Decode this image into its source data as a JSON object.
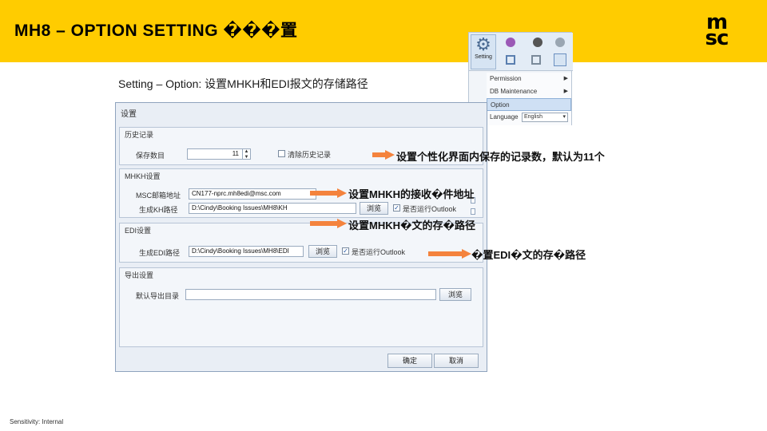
{
  "header": {
    "title": "MH8 – OPTION SETTING ���置",
    "logo_top": "m",
    "logo_bottom": "sc"
  },
  "ribbon": {
    "setting_label": "Setting",
    "menu": {
      "permission": "Permission",
      "db_maintenance": "DB Maintenance",
      "option": "Option",
      "language_label": "Language",
      "language_value": "English"
    }
  },
  "subtitle": "Setting – Option: 设置MHKH和EDI报文的存储路径",
  "dialog": {
    "title": "设置",
    "history": {
      "group_title": "历史记录",
      "count_label": "保存数目",
      "count_value": "11",
      "clear_label": "清除历史记录"
    },
    "mhkh": {
      "group_title": "MHKH设置",
      "email_label": "MSC邮箱地址",
      "email_value": "CN177-nprc.mh8edi@msc.com",
      "path_label": "生成KH路径",
      "path_value": "D:\\Cindy\\Booking Issues\\MH8\\KH",
      "browse_label": "浏览",
      "outlook_label": "是否运行Outlook"
    },
    "edi": {
      "group_title": "EDI设置",
      "path_label": "生成EDI路径",
      "path_value": "D:\\Cindy\\Booking Issues\\MH8\\EDI",
      "browse_label": "浏览",
      "outlook_label": "是否运行Outlook"
    },
    "export": {
      "group_title": "导出设置",
      "dir_label": "默认导出目录",
      "dir_value": "",
      "browse_label": "浏览"
    },
    "ok_label": "确定",
    "cancel_label": "取消"
  },
  "annotations": {
    "note1": "设置个性化界面内保存的记录数，默认为11个",
    "note2": "设置MHKH的接收�件地址",
    "note3": "设置MHKH�文的存�路径",
    "note4": "�置EDI�文的存�路径"
  },
  "footer": "Sensitivity: Internal",
  "colors": {
    "brand_yellow": "#FFCC00",
    "arrow_orange": "#F4833D"
  }
}
